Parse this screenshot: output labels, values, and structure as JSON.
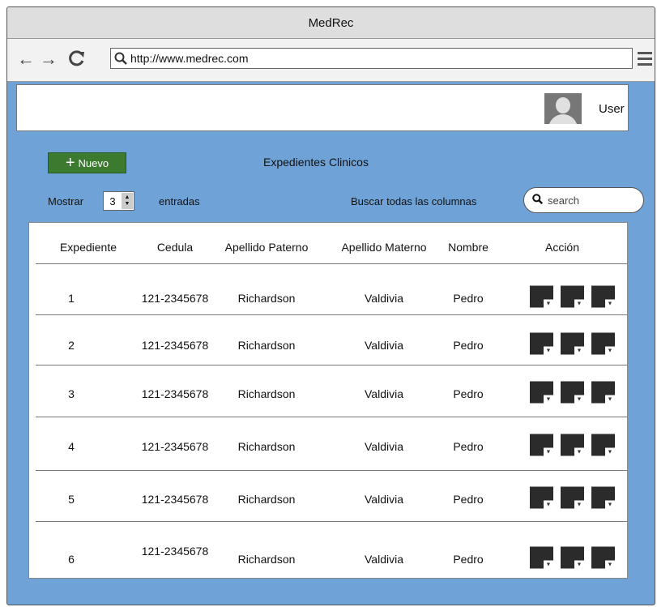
{
  "window": {
    "title": "MedRec"
  },
  "browser": {
    "url": "http://www.medrec.com",
    "icons": [
      "back-icon",
      "forward-icon",
      "refresh-icon",
      "search-icon",
      "menu-icon"
    ]
  },
  "header": {
    "user_label": "User"
  },
  "toolbar": {
    "new_label": "Nuevo",
    "page_title": "Expedientes Clinicos",
    "show_label": "Mostrar",
    "show_value": "3",
    "entries_label": "entradas",
    "search_label": "Buscar todas las columnas",
    "search_placeholder": "search"
  },
  "table": {
    "columns": [
      "Expediente",
      "Cedula",
      "Apellido Paterno",
      "Apellido Materno",
      "Nombre",
      "Acción"
    ],
    "rows": [
      {
        "expediente": "1",
        "cedula": "121-2345678",
        "apellido_paterno": "Richardson",
        "apellido_materno": "Valdivia",
        "nombre": "Pedro"
      },
      {
        "expediente": "2",
        "cedula": "121-2345678",
        "apellido_paterno": "Richardson",
        "apellido_materno": "Valdivia",
        "nombre": "Pedro"
      },
      {
        "expediente": "3",
        "cedula": "121-2345678",
        "apellido_paterno": "Richardson",
        "apellido_materno": "Valdivia",
        "nombre": "Pedro"
      },
      {
        "expediente": "4",
        "cedula": "121-2345678",
        "apellido_paterno": "Richardson",
        "apellido_materno": "Valdivia",
        "nombre": "Pedro"
      },
      {
        "expediente": "5",
        "cedula": "121-2345678",
        "apellido_paterno": "Richardson",
        "apellido_materno": "Valdivia",
        "nombre": "Pedro"
      },
      {
        "expediente": "6",
        "cedula": "121-2345678",
        "apellido_paterno": "Richardson",
        "apellido_materno": "Valdivia",
        "nombre": "Pedro"
      }
    ]
  },
  "colors": {
    "page_bg": "#6fa3d8",
    "new_button": "#3b7a2f",
    "action_button": "#2b2b2b"
  }
}
